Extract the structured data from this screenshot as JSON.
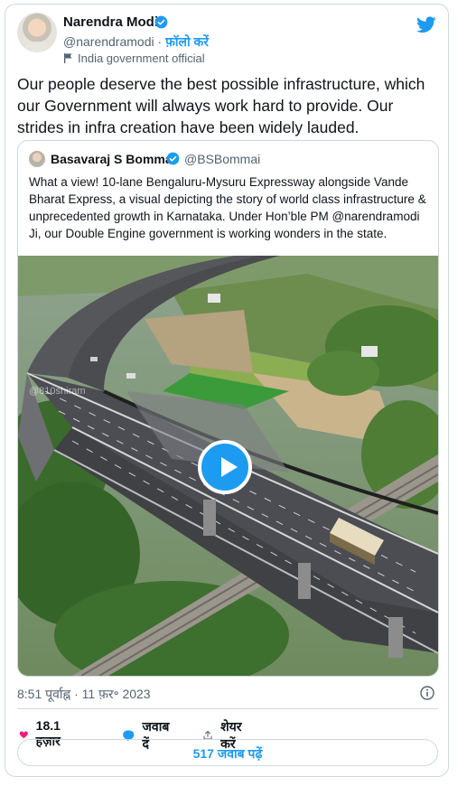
{
  "author": {
    "name": "Narendra Modi",
    "handle": "@narendramodi",
    "separator": " · ",
    "follow_label": "फ़ॉलो करें",
    "label": "India government official"
  },
  "tweet": {
    "text": "Our people deserve the best possible infrastructure, which our Government will always work hard to provide. Our strides in infra creation have been widely lauded."
  },
  "quoted": {
    "name": "Basavaraj S Bommai",
    "handle": "@BSBommai",
    "text": "What a view! 10-lane Bengaluru-Mysuru Expressway alongside Vande Bharat Express, a visual depicting the story of world class infrastructure & unprecedented growth in Karnataka. Under Hon’ble PM @narendramodi Ji, our Double Engine government is working wonders in the state.",
    "media_watermark": "@810shiram"
  },
  "meta": {
    "timestamp": "8:51 पूर्वाह्न · 11 फ़र॰ 2023"
  },
  "actions": {
    "likes": "18.1 हज़ार",
    "reply_label": "जवाब दें",
    "share_label": "शेयर करें"
  },
  "read_replies_label": "517 जवाब पढ़ें",
  "colors": {
    "accent": "#1d9bf0",
    "like": "#f91880",
    "border": "#cfd9de"
  },
  "icons": [
    "twitter-bird-icon",
    "verified-badge-icon",
    "government-flag-icon",
    "play-icon",
    "info-icon",
    "heart-icon",
    "reply-icon",
    "share-icon"
  ]
}
